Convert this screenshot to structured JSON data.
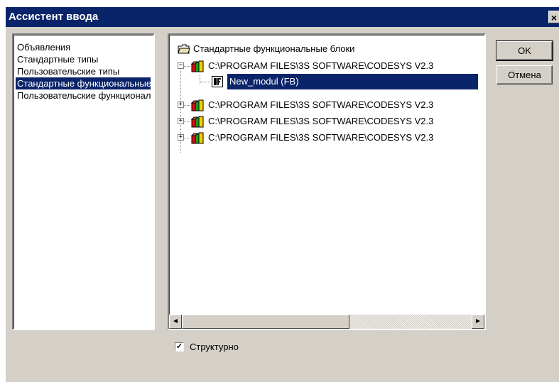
{
  "window": {
    "title": "Ассистент ввода",
    "close_glyph": "×"
  },
  "categories": {
    "items": [
      {
        "label": "Объявления",
        "selected": false
      },
      {
        "label": "Стандартные типы",
        "selected": false
      },
      {
        "label": "Пользовательские типы",
        "selected": false
      },
      {
        "label": "Стандартные функциональные блоки",
        "selected": true
      },
      {
        "label": "Пользовательские функциональные блоки",
        "selected": false
      }
    ]
  },
  "tree": {
    "root": {
      "label": "Стандартные функциональные блоки",
      "icon": "folder-icon"
    },
    "libraries": [
      {
        "label": "C:\\PROGRAM FILES\\3S SOFTWARE\\CODESYS V2.3",
        "expanded": true,
        "icon": "library-icon",
        "expander": "−"
      },
      {
        "label": "C:\\PROGRAM FILES\\3S SOFTWARE\\CODESYS V2.3",
        "expanded": false,
        "icon": "library-icon",
        "expander": "+"
      },
      {
        "label": "C:\\PROGRAM FILES\\3S SOFTWARE\\CODESYS V2.3",
        "expanded": false,
        "icon": "library-icon",
        "expander": "+"
      },
      {
        "label": "C:\\PROGRAM FILES\\3S SOFTWARE\\CODESYS V2.3",
        "expanded": false,
        "icon": "library-icon",
        "expander": "+"
      }
    ],
    "child": {
      "label": "New_modul (FB)",
      "icon": "function-block-icon",
      "selected": true
    }
  },
  "scrollbar": {
    "left_arrow": "◄",
    "right_arrow": "►"
  },
  "buttons": {
    "ok": "OK",
    "cancel": "Отмена"
  },
  "structured": {
    "label": "Структурно",
    "checked": true,
    "check_glyph": "✓"
  },
  "colors": {
    "selection": "#0a246a",
    "face": "#d4d0c8"
  }
}
